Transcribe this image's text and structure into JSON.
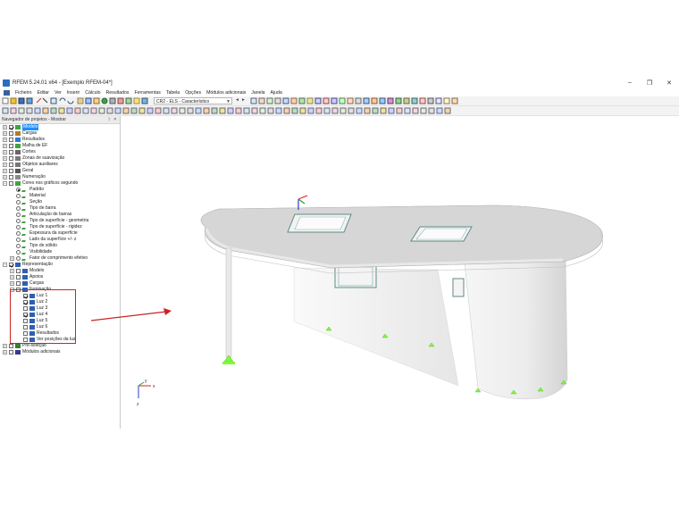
{
  "window": {
    "title": "RFEM 5.24.01 x64 - [Exemplo RFEM-04*]",
    "minimize": "–",
    "maximize": "❐",
    "close": "✕"
  },
  "menu": [
    "Ficheiro",
    "Editar",
    "Ver",
    "Inserir",
    "Cálculo",
    "Resultados",
    "Ferramentas",
    "Tabela",
    "Opções",
    "Módulos adicionais",
    "Janela",
    "Ajuda"
  ],
  "toolbar": {
    "load_combo": "CR2 - ELS - Característico",
    "prev": "◄",
    "next": "►"
  },
  "navigator": {
    "title": "Navegador de projetos - Mostrar",
    "pin": "ᛒ",
    "close": "✕",
    "items": [
      {
        "label": "Modelo",
        "level": 0,
        "exp": "+",
        "cb": "on",
        "icon": "model",
        "selected": true
      },
      {
        "label": "Cargas",
        "level": 0,
        "exp": "+",
        "cb": "",
        "icon": "load"
      },
      {
        "label": "Resultados",
        "level": 0,
        "exp": "+",
        "cb": "",
        "icon": "result"
      },
      {
        "label": "Malha de EF",
        "level": 0,
        "exp": "+",
        "cb": "",
        "icon": "mesh"
      },
      {
        "label": "Cortes",
        "level": 0,
        "exp": "+",
        "cb": "",
        "icon": "cut"
      },
      {
        "label": "Zonas de suavização",
        "level": 0,
        "exp": "+",
        "cb": "",
        "icon": "zone"
      },
      {
        "label": "Objetos auxiliares",
        "level": 0,
        "exp": "+",
        "cb": "",
        "icon": "aux"
      },
      {
        "label": "Geral",
        "level": 0,
        "exp": "+",
        "cb": "",
        "icon": "gen"
      },
      {
        "label": "Numeração",
        "level": 0,
        "exp": "+",
        "cb": "",
        "icon": "num"
      },
      {
        "label": "Cores nos gráficos segundo",
        "level": 0,
        "exp": "-",
        "cb": "",
        "icon": "color"
      },
      {
        "label": "Padrão",
        "level": 1,
        "rb": "on",
        "icon": "tick"
      },
      {
        "label": "Material",
        "level": 1,
        "rb": "",
        "icon": "tick"
      },
      {
        "label": "Seção",
        "level": 1,
        "rb": "",
        "icon": "tick"
      },
      {
        "label": "Tipo de barra",
        "level": 1,
        "rb": "",
        "icon": "tick"
      },
      {
        "label": "Articulação de barras",
        "level": 1,
        "rb": "",
        "icon": "tick"
      },
      {
        "label": "Tipo de superfície - geometria",
        "level": 1,
        "rb": "",
        "icon": "tick"
      },
      {
        "label": "Tipo de superfície - rigidez",
        "level": 1,
        "rb": "",
        "icon": "tick"
      },
      {
        "label": "Espessura da superfície",
        "level": 1,
        "rb": "",
        "icon": "tick"
      },
      {
        "label": "Lado da superfície +/- z",
        "level": 1,
        "rb": "",
        "icon": "tick"
      },
      {
        "label": "Tipo de sólido",
        "level": 1,
        "rb": "",
        "icon": "tick"
      },
      {
        "label": "Visibilidade",
        "level": 1,
        "rb": "",
        "icon": "tick"
      },
      {
        "label": "Fator de comprimento efetivo",
        "level": 1,
        "rb": "",
        "icon": "tick",
        "exp": "+"
      },
      {
        "label": "Representação",
        "level": 0,
        "exp": "-",
        "cb": "on",
        "icon": "repr"
      },
      {
        "label": "Modelo",
        "level": 1,
        "exp": "+",
        "cb": "",
        "icon": "repr"
      },
      {
        "label": "Apoios",
        "level": 1,
        "exp": "+",
        "cb": "",
        "icon": "repr"
      },
      {
        "label": "Cargas",
        "level": 1,
        "exp": "+",
        "cb": "",
        "icon": "repr"
      },
      {
        "label": "Iluminação",
        "level": 1,
        "exp": "-",
        "cb": "",
        "icon": "repr"
      },
      {
        "label": "Luz 1",
        "level": 2,
        "cb": "on",
        "icon": "repr"
      },
      {
        "label": "Luz 2",
        "level": 2,
        "cb": "on",
        "icon": "repr"
      },
      {
        "label": "Luz 3",
        "level": 2,
        "cb": "",
        "icon": "repr"
      },
      {
        "label": "Luz 4",
        "level": 2,
        "cb": "on",
        "icon": "repr"
      },
      {
        "label": "Luz 5",
        "level": 2,
        "cb": "",
        "icon": "repr"
      },
      {
        "label": "Luz 6",
        "level": 2,
        "cb": "",
        "icon": "repr"
      },
      {
        "label": "Resultados",
        "level": 2,
        "cb": "",
        "icon": "repr"
      },
      {
        "label": "Ver posições da luz",
        "level": 2,
        "cb": "",
        "icon": "repr"
      },
      {
        "label": "Pré-seleção",
        "level": 0,
        "exp": "+",
        "cb": "",
        "icon": "pre"
      },
      {
        "label": "Módulos adicionais",
        "level": 0,
        "exp": "+",
        "cb": "",
        "icon": "addon"
      }
    ]
  },
  "axes": {
    "x": "x",
    "y": "y",
    "z": "z"
  },
  "colors": {
    "accent": "#1e90ff",
    "highlight": "#cc2222",
    "support": "#7cfc3a"
  }
}
